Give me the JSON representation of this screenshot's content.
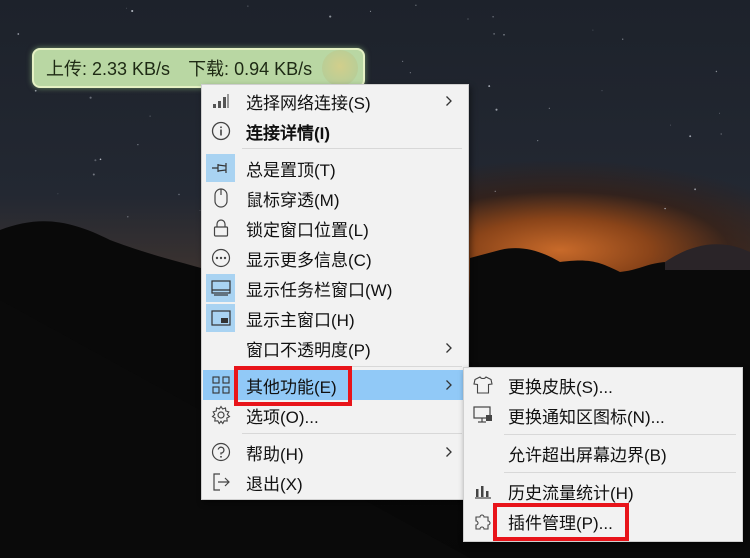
{
  "widget": {
    "upload": "上传: 2.33 KB/s",
    "download": "下载: 0.94 KB/s"
  },
  "main_menu": {
    "items": [
      {
        "label": "选择网络连接(S)",
        "icon": "signal-bars-icon",
        "submenu": true
      },
      {
        "label": "连接详情(I)",
        "icon": "info-icon",
        "bold": true
      },
      {
        "label": "总是置顶(T)",
        "icon": "pin-icon",
        "checked": true
      },
      {
        "label": "鼠标穿透(M)",
        "icon": "mouse-icon"
      },
      {
        "label": "锁定窗口位置(L)",
        "icon": "lock-icon"
      },
      {
        "label": "显示更多信息(C)",
        "icon": "more-dots-icon"
      },
      {
        "label": "显示任务栏窗口(W)",
        "icon": "taskbar-icon",
        "checked": true
      },
      {
        "label": "显示主窗口(H)",
        "icon": "window-icon",
        "checked": true
      },
      {
        "label": "窗口不透明度(P)",
        "submenu": true
      },
      {
        "label": "其他功能(E)",
        "icon": "grid-apps-icon",
        "submenu": true,
        "highlighted": true
      },
      {
        "label": "选项(O)...",
        "icon": "gear-icon"
      },
      {
        "label": "帮助(H)",
        "icon": "help-icon",
        "submenu": true
      },
      {
        "label": "退出(X)",
        "icon": "exit-icon"
      }
    ]
  },
  "sub_menu": {
    "items": [
      {
        "label": "更换皮肤(S)...",
        "icon": "shirt-icon"
      },
      {
        "label": "更换通知区图标(N)...",
        "icon": "monitor-icon"
      },
      {
        "label": "允许超出屏幕边界(B)"
      },
      {
        "label": "历史流量统计(H)",
        "icon": "bar-chart-icon"
      },
      {
        "label": "插件管理(P)...",
        "icon": "puzzle-icon"
      }
    ]
  },
  "colors": {
    "highlight": "#91c9f7",
    "checked_icon_bg": "#a9d3f2",
    "annotation_red": "#e8141a",
    "widget_bg": "#b9d7a3"
  }
}
